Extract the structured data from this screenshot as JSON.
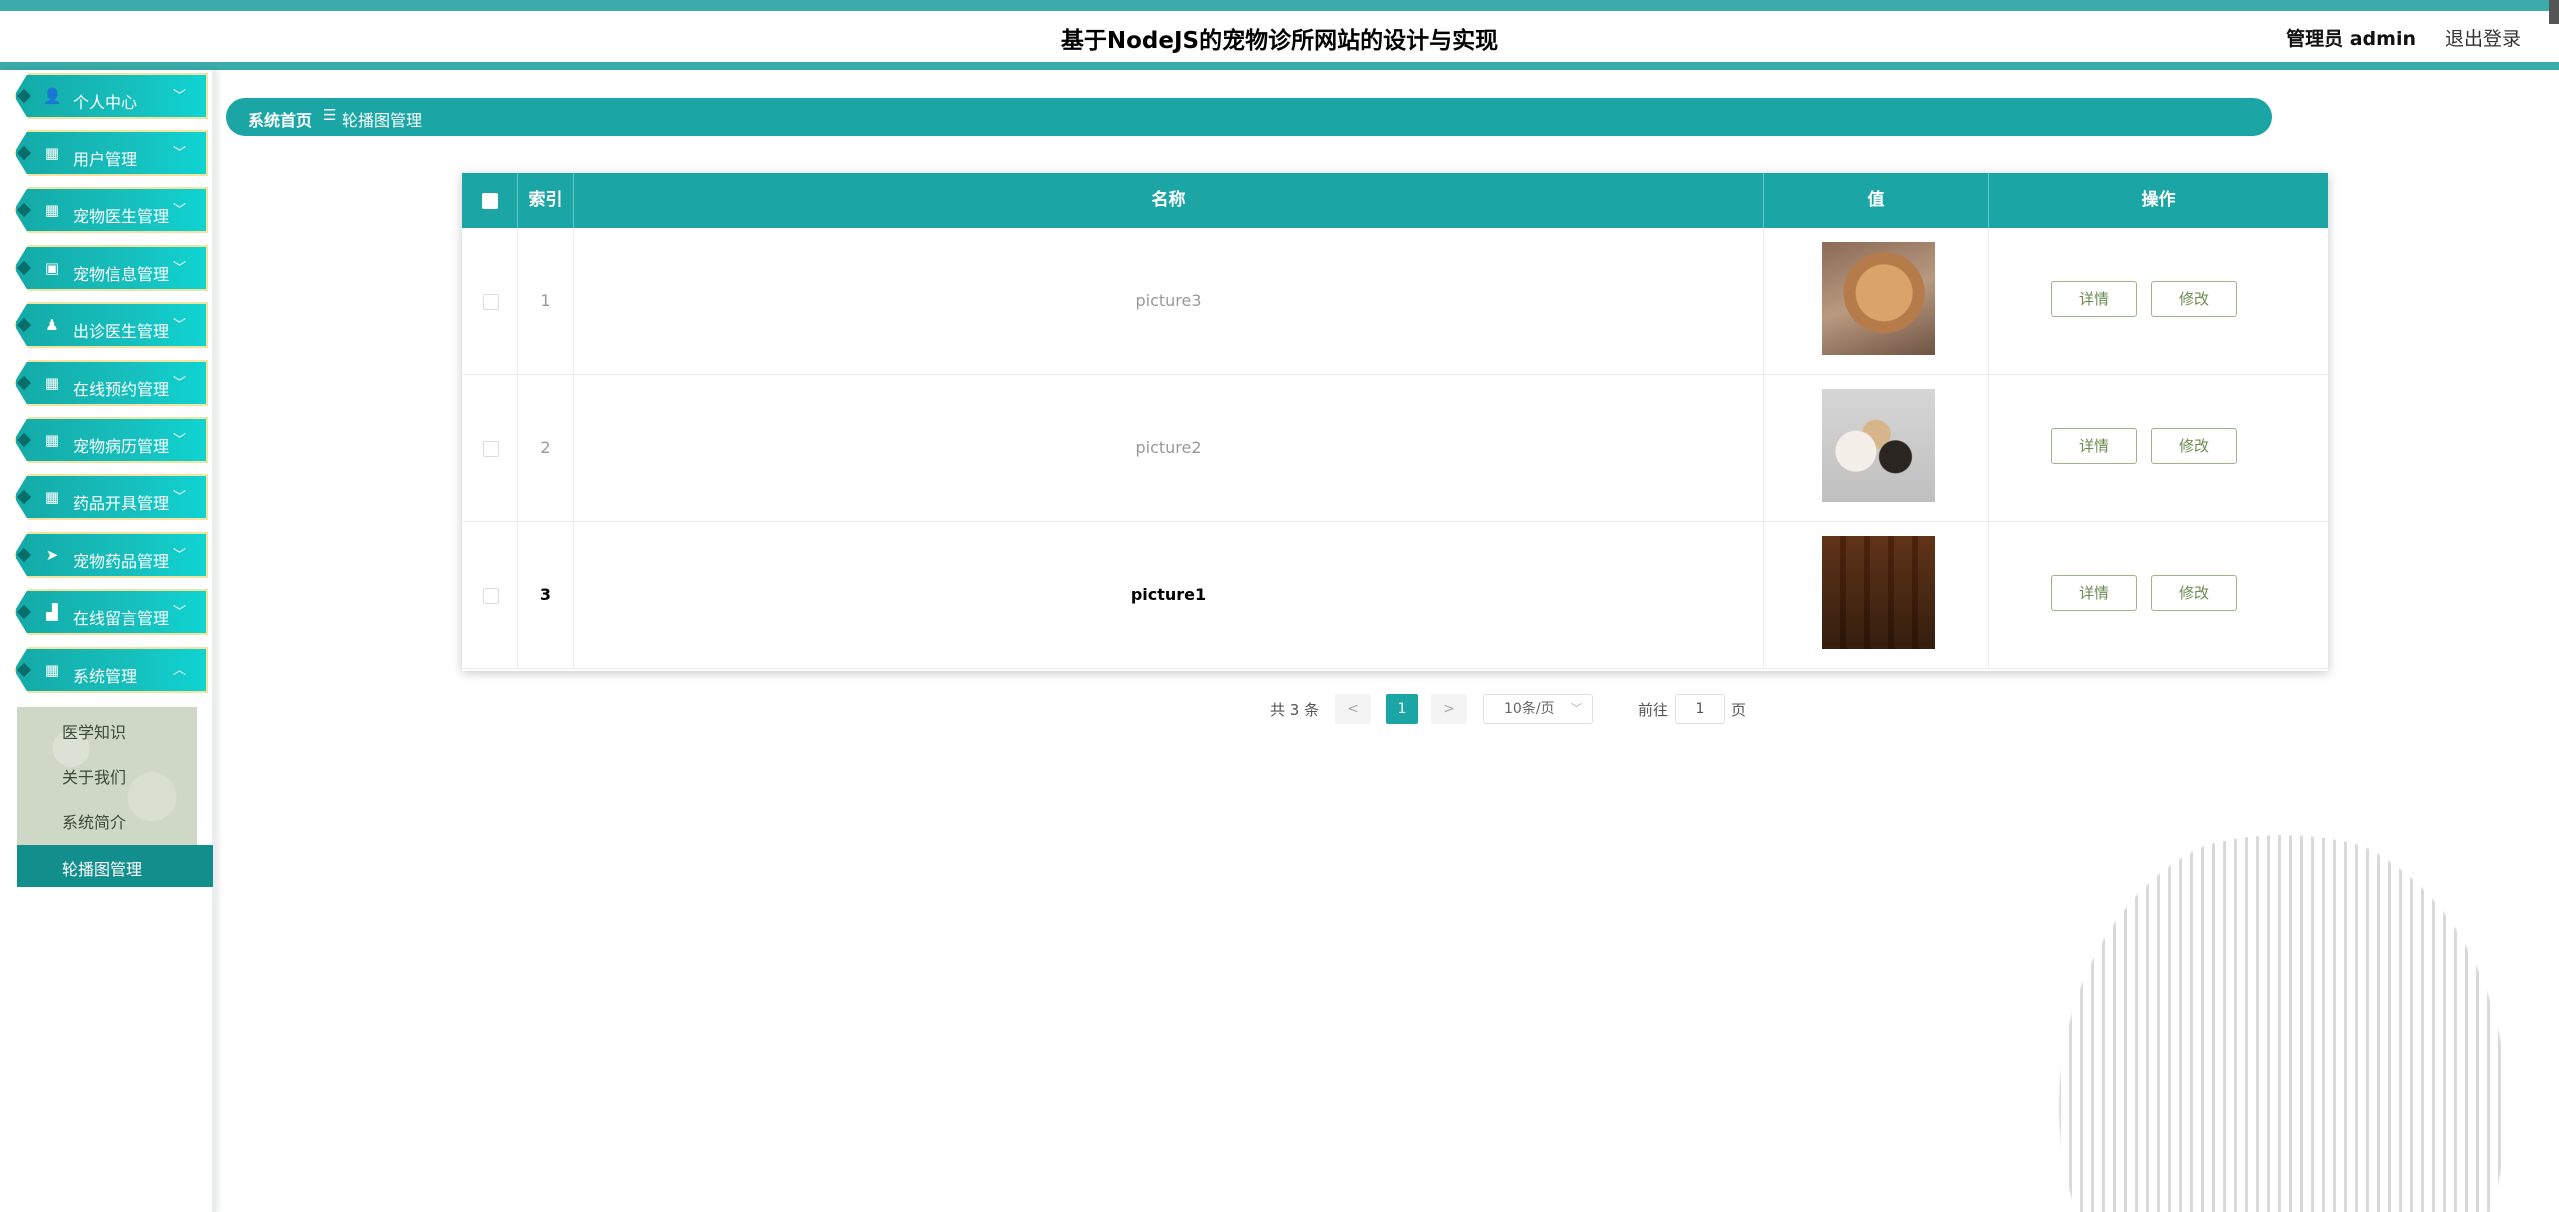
{
  "header": {
    "title": "基于NodeJS的宠物诊所网站的设计与实现",
    "user_label": "管理员 admin",
    "logout_label": "退出登录"
  },
  "sidebar": {
    "items": [
      {
        "label": "个人中心",
        "icon": "user-icon"
      },
      {
        "label": "用户管理",
        "icon": "grid-icon"
      },
      {
        "label": "宠物医生管理",
        "icon": "grid-icon"
      },
      {
        "label": "宠物信息管理",
        "icon": "briefcase-icon"
      },
      {
        "label": "出诊医生管理",
        "icon": "stamp-icon"
      },
      {
        "label": "在线预约管理",
        "icon": "grid-icon"
      },
      {
        "label": "宠物病历管理",
        "icon": "grid-icon"
      },
      {
        "label": "药品开具管理",
        "icon": "grid-icon"
      },
      {
        "label": "宠物药品管理",
        "icon": "send-icon"
      },
      {
        "label": "在线留言管理",
        "icon": "factory-icon"
      },
      {
        "label": "系统管理",
        "icon": "grid-icon"
      }
    ],
    "submenu": [
      "医学知识",
      "关于我们",
      "系统简介",
      "轮播图管理"
    ]
  },
  "breadcrumb": {
    "home": "系统首页",
    "separator": "☰",
    "current": "轮播图管理"
  },
  "table": {
    "columns": [
      "索引",
      "名称",
      "值",
      "操作"
    ],
    "rows": [
      {
        "index": "1",
        "name": "picture3",
        "image": "puppy"
      },
      {
        "index": "2",
        "name": "picture2",
        "image": "puppies-group"
      },
      {
        "index": "3",
        "name": "picture1",
        "image": "puppies-row"
      }
    ],
    "detail_label": "详情",
    "edit_label": "修改"
  },
  "pagination": {
    "total": "共 3 条",
    "prev": "<",
    "current_page": "1",
    "next": ">",
    "page_size": "10条/页",
    "goto_label": "前往",
    "goto_value": "1",
    "goto_suffix": "页"
  },
  "colors": {
    "accent": "#1ba5a4",
    "header_border": "#3aaca9",
    "button_text": "#6d8a52"
  }
}
